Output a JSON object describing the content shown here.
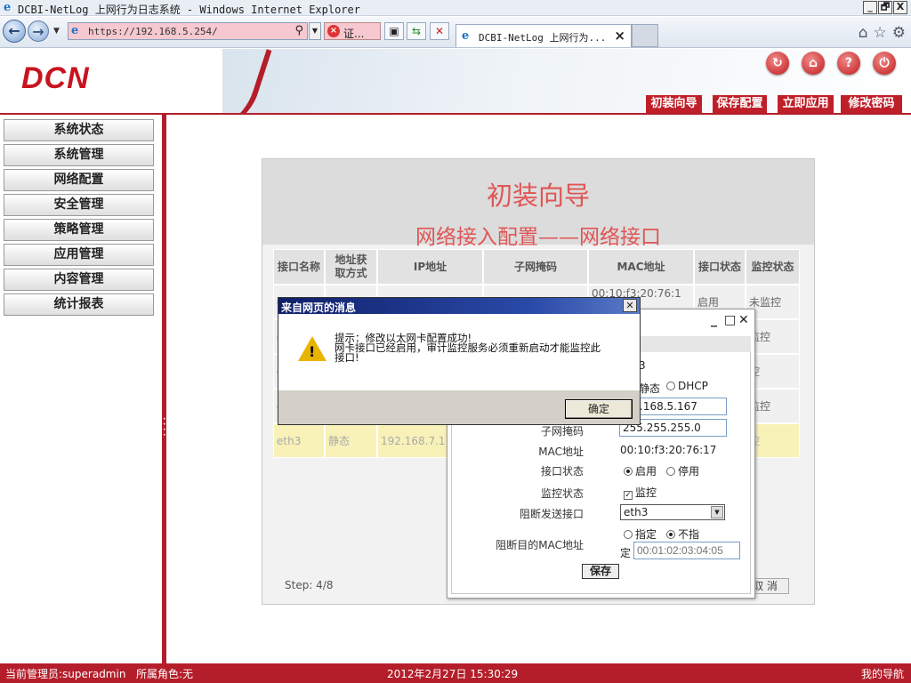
{
  "browser": {
    "window_title": "DCBI-NetLog 上网行为日志系统 - Windows Internet Explorer",
    "url": "https://192.168.5.254/",
    "cert_label": "证...",
    "tab_title": "DCBI-NetLog 上网行为...",
    "window_buttons": [
      "_",
      "🗗",
      "X"
    ]
  },
  "header": {
    "logo": "DCN",
    "icons": [
      "refresh-icon",
      "home-icon",
      "help-icon",
      "power-icon"
    ],
    "menu": [
      "初装向导",
      "保存配置",
      "立即应用",
      "修改密码"
    ]
  },
  "sidebar": {
    "items": [
      "系统状态",
      "系统管理",
      "网络配置",
      "安全管理",
      "策略管理",
      "应用管理",
      "内容管理",
      "统计报表"
    ]
  },
  "wizard": {
    "title": "初装向导",
    "subtitle": "网络接入配置——网络接口",
    "columns": [
      "接口名称",
      "地址获取方式",
      "IP地址",
      "子网掩码",
      "MAC地址",
      "接口状态",
      "监控状态"
    ],
    "rows": [
      [
        "e",
        "",
        "",
        "",
        "00:10:f3:20:76:1",
        "启用",
        "未监控"
      ],
      [
        "e\n2",
        "",
        "",
        "",
        "",
        "",
        "监控"
      ],
      [
        "e",
        "",
        "",
        "",
        "",
        "",
        "控"
      ],
      [
        "e",
        "",
        "",
        "",
        "",
        "",
        "监控"
      ],
      [
        "eth3",
        "静态",
        "192.168.7.1",
        "",
        "",
        "",
        "控"
      ]
    ],
    "step": "Step: 4/8",
    "cancel_fragment": "取 消"
  },
  "popup": {
    "partial_top": "3",
    "mode_static": "静态",
    "mode_dhcp": "DHCP",
    "ip_value": ".168.5.167",
    "mask_label": "子网掩码",
    "mask_value": "255.255.255.0",
    "mac_label": "MAC地址",
    "mac_value": "00:10:f3:20:76:17",
    "iface_status_label": "接口状态",
    "enable": "启用",
    "disable": "停用",
    "monitor_label": "监控状态",
    "monitor_option": "监控",
    "block_iface_label": "阻断发送接口",
    "block_iface_value": "eth3",
    "block_mac_label": "阻断目的MAC地址",
    "specify": "指定",
    "not_specify": "不指",
    "not_specify_tail": "定",
    "block_mac_placeholder": "00:01:02:03:04:05",
    "save": "保存"
  },
  "alert": {
    "title": "来自网页的消息",
    "line1": "提示：修改以太网卡配置成功!",
    "line2": "网卡接口已经启用，审计监控服务必须重新启动才能监控此",
    "line3": "接口!",
    "ok": "确定"
  },
  "status": {
    "admin": "当前管理员:superadmin",
    "role": "所属角色:无",
    "datetime": "2012年2月27日 15:30:29",
    "nav": "我的导航"
  }
}
